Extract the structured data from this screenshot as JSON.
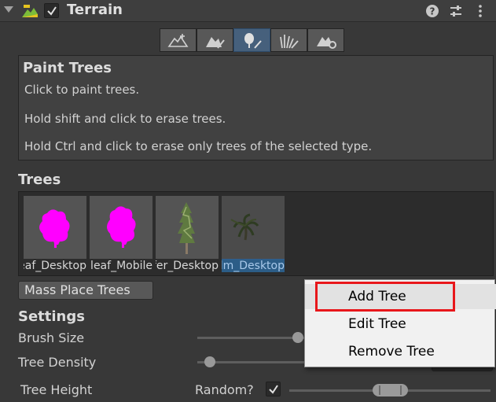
{
  "header": {
    "title": "Terrain",
    "enabled": true,
    "icons": [
      "terrain-icon",
      "help-icon",
      "preset-icon",
      "more-options-icon"
    ]
  },
  "toolbar": {
    "tools": [
      {
        "name": "create-neighbor-terrains",
        "icon": "terrain-plus-icon"
      },
      {
        "name": "paint-terrain",
        "icon": "terrain-brush-icon"
      },
      {
        "name": "paint-trees",
        "icon": "tree-brush-icon",
        "active": true
      },
      {
        "name": "paint-details",
        "icon": "grass-brush-icon"
      },
      {
        "name": "terrain-settings",
        "icon": "terrain-gear-icon"
      }
    ]
  },
  "help": {
    "title": "Paint Trees",
    "line1": "Click to paint trees.",
    "line2": "Hold shift and click to erase trees.",
    "line3": "Hold Ctrl and click to erase only trees of the selected type."
  },
  "trees": {
    "title": "Trees",
    "items": [
      {
        "label": "Broadleaf_Desktop"
      },
      {
        "label": "Broadleaf_Mobile"
      },
      {
        "label": "Conifer_Desktop"
      },
      {
        "label": "Palm_Desktop",
        "selected": true
      }
    ],
    "mass_place_label": "Mass Place Trees"
  },
  "settings": {
    "title": "Settings",
    "brush_size_label": "Brush Size",
    "brush_size_level": 0.6,
    "tree_density_label": "Tree Density",
    "tree_density_level": 0.1,
    "tree_height_label": "Tree Height",
    "random_label": "Random?",
    "random_checked": true
  },
  "context_menu": {
    "items": [
      "Add Tree",
      "Edit Tree",
      "Remove Tree"
    ],
    "hovered_index": 0
  },
  "colors": {
    "accent": "#2c5d87",
    "highlight": "#e8171b",
    "missing_material": "#ff00ff"
  }
}
